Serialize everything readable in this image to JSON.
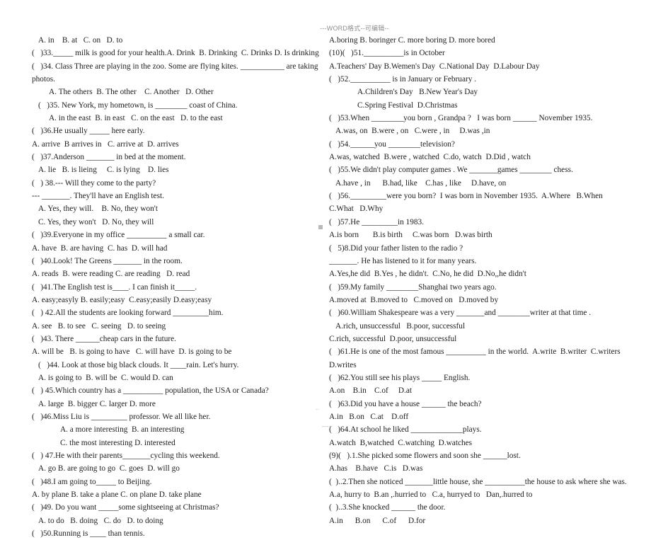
{
  "header": {
    "watermark": "---WORD格式--可编辑--"
  },
  "artifacts": {
    "foot_dashes": "----",
    "edge_speck": "--"
  },
  "left_column": {
    "lines": [
      {
        "indent": 1,
        "text": "A. in    B. at   C. on   D. to"
      },
      {
        "indent": 0,
        "text": "(   )33._____ milk is good for your health.A. Drink  B. Drinking  C. Drinks D. Is drinking"
      },
      {
        "indent": 0,
        "text": "(   )34. Class Three are playing in the zoo. Some are flying kites. ___________ are taking"
      },
      {
        "indent": 0,
        "text": "photos."
      },
      {
        "indent": 2,
        "text": "A. The others  B. The other    C. Another   D. Other"
      },
      {
        "indent": 1,
        "text": "(   )35. New York, my hometown, is ________ coast of China."
      },
      {
        "indent": 2,
        "text": "A. in the east  B. in east   C. on the east   D. to the east"
      },
      {
        "indent": 0,
        "text": "(   )36.He usually _____ here early."
      },
      {
        "indent": 0,
        "text": "A. arrive  B arrives in   C. arrive at  D. arrives"
      },
      {
        "indent": 0,
        "text": "(   )37.Anderson _______ in bed at the moment."
      },
      {
        "indent": 1,
        "text": "A. lie   B. is lieing     C. is lying    D. lies"
      },
      {
        "indent": 0,
        "text": "(   ) 38.--- Will they come to the party?"
      },
      {
        "indent": 0,
        "text": "--- _______. They'll have an English test."
      },
      {
        "indent": 1,
        "text": "A. Yes, they will.    B. No, they won't"
      },
      {
        "indent": 1,
        "text": "C. Yes, they won't   D. No, they will"
      },
      {
        "indent": 0,
        "text": "(   )39.Everyone in my office __________ a small car."
      },
      {
        "indent": 0,
        "text": "A. have  B. are having  C. has  D. will had"
      },
      {
        "indent": 0,
        "text": "(   )40.Look! The Greens _______ in the room."
      },
      {
        "indent": 0,
        "text": "A. reads  B. were reading C. are reading   D. read"
      },
      {
        "indent": 0,
        "text": "(   )41.The English test is____. I can finish it_____."
      },
      {
        "indent": 0,
        "text": "A. easy;easyly B. easily;easy  C.easy;easily D.easy;easy"
      },
      {
        "indent": 0,
        "text": "(   ) 42.All the students are looking forward _________him."
      },
      {
        "indent": 0,
        "text": "A. see   B. to see   C. seeing   D. to seeing"
      },
      {
        "indent": 0,
        "text": "(   )43. There ______cheap cars in the future."
      },
      {
        "indent": 0,
        "text": "A. will be   B. is going to have   C. will have  D. is going to be"
      },
      {
        "indent": 1,
        "text": "(   )44. Look at those big black clouds. It ____rain. Let's hurry."
      },
      {
        "indent": 1,
        "text": "A. is going to  B. will be  C. would D. can"
      },
      {
        "indent": 0,
        "text": "(   ) 45.Which country has a __________ population, the USA or Canada?"
      },
      {
        "indent": 1,
        "text": "A. large  B. bigger C. larger D. more"
      },
      {
        "indent": 0,
        "text": "(   )46.Miss Liu is _________ professor. We all like her."
      },
      {
        "indent": 3,
        "text": "A. a more interesting  B. an interesting"
      },
      {
        "indent": 3,
        "text": "C. the most interesting D. interested"
      },
      {
        "indent": 0,
        "text": "(   ) 47.He with their parents_______cycling this weekend."
      },
      {
        "indent": 1,
        "text": "A. go B. are going to go  C. goes  D. will go"
      },
      {
        "indent": 0,
        "text": "(   )48.I am going to_____ to Beijing."
      },
      {
        "indent": 0,
        "text": "A. by plane B. take a plane C. on plane D. take plane"
      },
      {
        "indent": 0,
        "text": "(   )49. Do you want _____some sightseeing at Christmas?"
      },
      {
        "indent": 1,
        "text": "A. to do   B. doing   C. do   D. to doing"
      },
      {
        "indent": 0,
        "text": "(   )50.Running is ____ than tennis."
      }
    ]
  },
  "right_column": {
    "lines": [
      {
        "indent": 0,
        "text": "A.boring B. boringer C. more boring D. more bored"
      },
      {
        "indent": 0,
        "text": "(10)(   )51.__________is in October"
      },
      {
        "indent": 0,
        "text": "A.Teachers' Day B.Wemen's Day  C.National Day  D.Labour Day"
      },
      {
        "indent": 0,
        "text": "(   )52.__________ is in January or February ."
      },
      {
        "indent": 3,
        "text": "A.Children's Day   B.New Year's Day"
      },
      {
        "indent": 3,
        "text": "C.Spring Festival  D.Christmas"
      },
      {
        "indent": 0,
        "text": "(   )53.When ________you born , Grandpa ?   I was born ______ November 1935."
      },
      {
        "indent": 1,
        "text": "A.was, on  B.were , on   C.were , in     D.was ,in"
      },
      {
        "indent": 0,
        "text": "(   )54.______you ________television?"
      },
      {
        "indent": 0,
        "text": "A.was, watched  B.were , watched  C.do, watch  D.Did , watch"
      },
      {
        "indent": 0,
        "text": "(   )55.We didn't play computer games . We _______games ________ chess."
      },
      {
        "indent": 1,
        "text": "A.have , in      B.had, like    C.has , like     D.have, on"
      },
      {
        "indent": 0,
        "text": "(   )56._________were you born?  I was born in November 1935.  A.Where   B.When"
      },
      {
        "indent": 0,
        "text": "C.What   D.Why"
      },
      {
        "indent": 0,
        "text": "(   )57.He _________in 1983."
      },
      {
        "indent": 0,
        "text": "A.is born       B.is birth     C.was born   D.was birth"
      },
      {
        "indent": 0,
        "text": "(   5)8.Did your father listen to the radio ?"
      },
      {
        "indent": 0,
        "text": "_______. He has listened to it for many years."
      },
      {
        "indent": 0,
        "text": "A.Yes,he did  B.Yes , he didn't.  C.No, he did  D.No,,he didn't"
      },
      {
        "indent": 0,
        "text": "(   )59.My family ________Shanghai two years ago."
      },
      {
        "indent": 0,
        "text": "A.moved at  B.moved to   C.moved on   D.moved by"
      },
      {
        "indent": 0,
        "text": "(   )60.William Shakespeare was a very _______and ________writer at that time ."
      },
      {
        "indent": 1,
        "text": "A.rich, unsuccessful   B.poor, successful"
      },
      {
        "indent": 0,
        "text": "C.rich, successful  D.poor, unsuccessful"
      },
      {
        "indent": 0,
        "text": "(   )61.He is one of the most famous __________ in the world.  A.write  B.writer  C.writers"
      },
      {
        "indent": 0,
        "text": "D.writes"
      },
      {
        "indent": 0,
        "text": "(   )62.You still see his plays _____ English."
      },
      {
        "indent": 0,
        "text": "A.on    B.in    C.of     D.at"
      },
      {
        "indent": 0,
        "text": "(   )63.Did you have a house ______ the beach?"
      },
      {
        "indent": 0,
        "text": "A.in   B.on   C.at    D.off"
      },
      {
        "indent": 0,
        "text": "(   )64.At school he liked _____________plays."
      },
      {
        "indent": 0,
        "text": "A.watch  B,watched  C.watching  D.watches"
      },
      {
        "indent": 0,
        "text": "(9)(   ).1.She picked some flowers and soon she ______lost."
      },
      {
        "indent": 0,
        "text": "A.has    B.have   C.is   D.was"
      },
      {
        "indent": 0,
        "text": "(  )..2.Then she noticed _______little house, she __________the house to ask where she was."
      },
      {
        "indent": 0,
        "text": "A.a, hurry to  B.an ,.hurried to   C.a, hurryed to   Dan,.hurred to"
      },
      {
        "indent": 0,
        "text": "(  )..3.She knocked ______ the door."
      },
      {
        "indent": 0,
        "text": "A.in      B.on      C.of      D.for"
      }
    ]
  }
}
